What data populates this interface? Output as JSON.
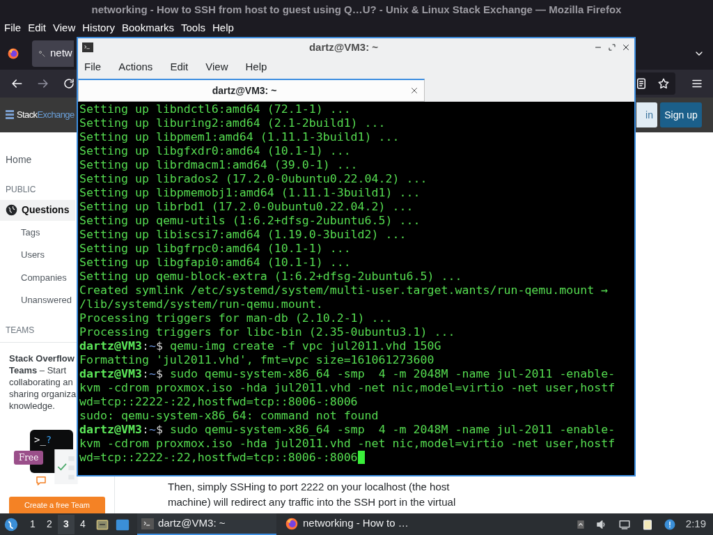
{
  "firefox": {
    "title": "networking - How to SSH from host to guest using Q…U? - Unix & Linux Stack Exchange — Mozilla Firefox",
    "menu": [
      "File",
      "Edit",
      "View",
      "History",
      "Bookmarks",
      "Tools",
      "Help"
    ],
    "tab": {
      "title": "netw"
    },
    "site": {
      "logo_first": "Stack",
      "logo_second": "Exchange",
      "login": "in",
      "signup": "Sign up"
    },
    "nav": [
      {
        "kind": "top",
        "label": "Home",
        "selected": false
      },
      {
        "kind": "heading",
        "label": "PUBLIC"
      },
      {
        "kind": "primary",
        "label": "Questions",
        "selected": true
      },
      {
        "kind": "sub",
        "label": "Tags",
        "selected": false
      },
      {
        "kind": "sub",
        "label": "Users",
        "selected": false
      },
      {
        "kind": "sub",
        "label": "Companies",
        "selected": false
      },
      {
        "kind": "sub",
        "label": "Unanswered",
        "selected": false
      },
      {
        "kind": "heading",
        "label": "TEAMS"
      }
    ],
    "teams_card": {
      "lines": [
        "**Stack Overflow**",
        "**Teams** – Start",
        "collaborating an",
        "sharing organiza",
        "knowledge."
      ],
      "prompt": ">_",
      "question": "?",
      "badge": "Free",
      "button": "Create a free Team"
    },
    "answer_lines": [
      "Then, simply SSHing to port 2222 on your localhost (the host",
      "machine) will redirect any traffic into the SSH port in the virtual"
    ]
  },
  "terminal": {
    "title": "dartz@VM3: ~",
    "menu": [
      "File",
      "Actions",
      "Edit",
      "View",
      "Help"
    ],
    "tab": {
      "title": "dartz@VM3: ~",
      "selected": true
    },
    "lines": [
      {
        "kind": "output",
        "text": "Setting up libndctl6:amd64 (72.1-1) ..."
      },
      {
        "kind": "output",
        "text": "Setting up liburing2:amd64 (2.1-2build1) ..."
      },
      {
        "kind": "output",
        "text": "Setting up libpmem1:amd64 (1.11.1-3build1) ..."
      },
      {
        "kind": "output",
        "text": "Setting up libgfxdr0:amd64 (10.1-1) ..."
      },
      {
        "kind": "output",
        "text": "Setting up librdmacm1:amd64 (39.0-1) ..."
      },
      {
        "kind": "output",
        "text": "Setting up librados2 (17.2.0-0ubuntu0.22.04.2) ..."
      },
      {
        "kind": "output",
        "text": "Setting up libpmemobj1:amd64 (1.11.1-3build1) ..."
      },
      {
        "kind": "output",
        "text": "Setting up librbd1 (17.2.0-0ubuntu0.22.04.2) ..."
      },
      {
        "kind": "output",
        "text": "Setting up qemu-utils (1:6.2+dfsg-2ubuntu6.5) ..."
      },
      {
        "kind": "output",
        "text": "Setting up libiscsi7:amd64 (1.19.0-3build2) ..."
      },
      {
        "kind": "output",
        "text": "Setting up libgfrpc0:amd64 (10.1-1) ..."
      },
      {
        "kind": "output",
        "text": "Setting up libgfapi0:amd64 (10.1-1) ..."
      },
      {
        "kind": "output",
        "text": "Setting up qemu-block-extra (1:6.2+dfsg-2ubuntu6.5) ..."
      },
      {
        "kind": "output",
        "text": "Created symlink /etc/systemd/system/multi-user.target.wants/run-qemu.mount →"
      },
      {
        "kind": "output",
        "text": "/lib/systemd/system/run-qemu.mount."
      },
      {
        "kind": "output",
        "text": "Processing triggers for man-db (2.10.2-1) ..."
      },
      {
        "kind": "output",
        "text": "Processing triggers for libc-bin (2.35-0ubuntu3.1) ..."
      },
      {
        "kind": "prompt",
        "user": "dartz@VM3",
        "sep": ":",
        "path": "~",
        "sign": "$",
        "command": "qemu-img create -f vpc jul2011.vhd 150G"
      },
      {
        "kind": "output",
        "text": "Formatting 'jul2011.vhd', fmt=vpc size=161061273600"
      },
      {
        "kind": "prompt",
        "user": "dartz@VM3",
        "sep": ":",
        "path": "~",
        "sign": "$",
        "command": "sudo qemu-system-x86_64 -smp  4 -m 2048M -name jul-2011 -enable-"
      },
      {
        "kind": "output",
        "text": "kvm -cdrom proxmox.iso -hda jul2011.vhd -net nic,model=virtio -net user,hostf"
      },
      {
        "kind": "output",
        "text": "wd=tcp::2222-:22,hostfwd=tcp::8006-:8006"
      },
      {
        "kind": "output",
        "text": "sudo: qemu-system-x86_64: command not found"
      },
      {
        "kind": "prompt",
        "user": "dartz@VM3",
        "sep": ":",
        "path": "~",
        "sign": "$",
        "command": "sudo qemu-system-x86_64 -smp  4 -m 2048M -name jul-2011 -enable-"
      },
      {
        "kind": "output",
        "text": "kvm -cdrom proxmox.iso -hda jul2011.vhd -net nic,model=virtio -net user,hostf"
      },
      {
        "kind": "output",
        "text": "wd=tcp::2222-:22,hostfwd=tcp::8006-:8006",
        "cursor": true
      }
    ]
  },
  "taskbar": {
    "workspaces": [
      {
        "label": "1",
        "selected": false
      },
      {
        "label": "2",
        "selected": false
      },
      {
        "label": "3",
        "selected": true
      },
      {
        "label": "4",
        "selected": false
      }
    ],
    "tasks": [
      {
        "kind": "terminal",
        "label": "dartz@VM3: ~",
        "active": true
      },
      {
        "kind": "browser",
        "label": "networking - How to …",
        "active": false
      }
    ],
    "clock": "2:19"
  }
}
